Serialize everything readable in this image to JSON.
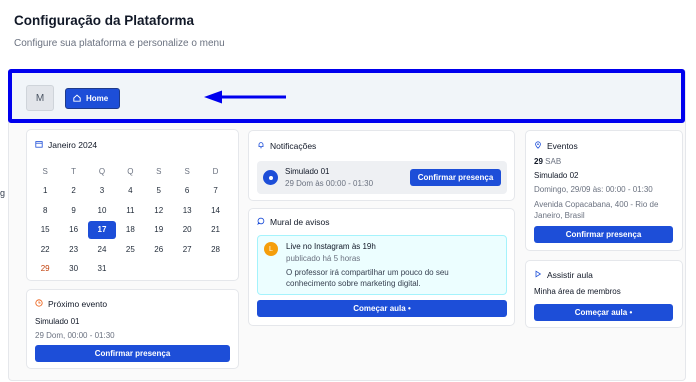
{
  "header": {
    "title": "Configuração da Plataforma",
    "subtitle": "Configure sua plataforma e personalize o menu"
  },
  "topbar": {
    "avatar_letter": "M",
    "home_label": "Home",
    "icon": "home-icon"
  },
  "colors": {
    "accent": "#1d4ed8",
    "highlight_border": "#0000ee",
    "arrow": "#0000ee"
  },
  "calendar": {
    "month": "Janeiro 2024",
    "weekdays": [
      "S",
      "T",
      "Q",
      "Q",
      "S",
      "S",
      "D"
    ],
    "weeks": [
      [
        "1",
        "2",
        "3",
        "4",
        "5",
        "6",
        "7"
      ],
      [
        "8",
        "9",
        "10",
        "11",
        "12",
        "13",
        "14"
      ],
      [
        "15",
        "16",
        "17",
        "18",
        "19",
        "20",
        "21"
      ],
      [
        "22",
        "23",
        "24",
        "25",
        "26",
        "27",
        "28"
      ],
      [
        "29",
        "30",
        "31",
        "",
        "",
        "",
        ""
      ]
    ],
    "today": "17"
  },
  "next_event": {
    "title": "Próximo evento",
    "name": "Simulado 01",
    "when": "29 Dom, 00:00 - 01:30",
    "button": "Confirmar presença"
  },
  "notifications": {
    "title": "Notificações",
    "item_name": "Simulado 01",
    "item_when": "29 Dom às 00:00 - 01:30",
    "button": "Confirmar presença"
  },
  "mural": {
    "title": "Mural de avisos",
    "avatar_letter": "L",
    "post_title": "Live no Instagram às 19h",
    "post_time": "publicado há 5 horas",
    "post_body": "O professor irá compartilhar um pouco do seu conhecimento sobre marketing digital.",
    "button": "Começar aula •"
  },
  "events": {
    "title": "Eventos",
    "day": "29",
    "day_label": "SAB",
    "name": "Simulado 02",
    "when": "Domingo, 29/09 às: 00:00 - 01:30",
    "address": "Avenida Copacabana, 400 - Rio de Janeiro, Brasil",
    "button": "Confirmar presença"
  },
  "watch": {
    "title": "Assistir aula",
    "subtitle": "Minha área de membros",
    "button": "Começar aula •"
  },
  "left_sliver": "g"
}
